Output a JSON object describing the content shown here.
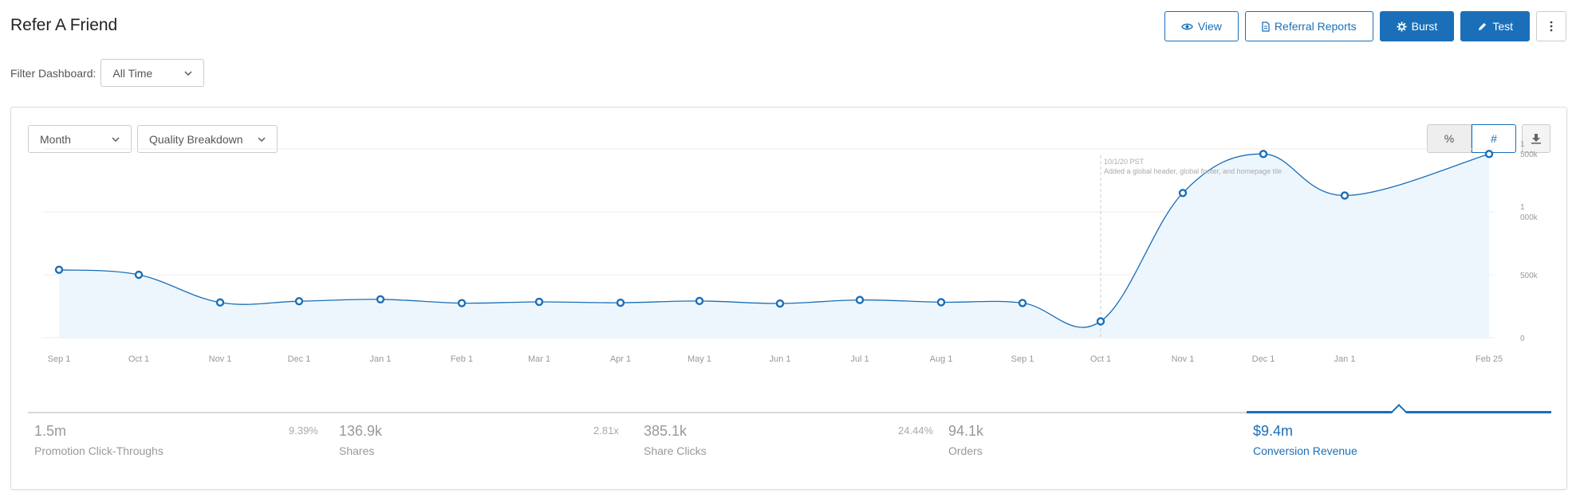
{
  "page": {
    "title": "Refer A Friend"
  },
  "toolbar": {
    "view_label": "View",
    "reports_label": "Referral Reports",
    "burst_label": "Burst",
    "test_label": "Test"
  },
  "filter": {
    "label": "Filter Dashboard:",
    "value": "All Time"
  },
  "panel": {
    "period_select": "Month",
    "breakdown_select": "Quality Breakdown",
    "toggle_percent": "%",
    "toggle_count": "#"
  },
  "colors": {
    "accent": "#1a6fb8",
    "area_fill": "#eef6fd",
    "grid": "#ececec",
    "tick_text": "#999999"
  },
  "chart_data": {
    "type": "area",
    "x": [
      "Sep 1",
      "Oct 1",
      "Nov 1",
      "Dec 1",
      "Jan 1",
      "Feb 1",
      "Mar 1",
      "Apr 1",
      "May 1",
      "Jun 1",
      "Jul 1",
      "Aug 1",
      "Sep 1",
      "Oct 1",
      "Nov 1",
      "Dec 1",
      "Jan 1",
      "Feb 25"
    ],
    "y_ticks": [
      "0",
      "500k",
      "1 000k",
      "1 500k"
    ],
    "ylim": [
      0,
      1500000
    ],
    "series": [
      {
        "values": [
          540000,
          500000,
          280000,
          290000,
          305000,
          275000,
          285000,
          278000,
          292000,
          272000,
          300000,
          282000,
          276000,
          130000,
          1150000,
          1460000,
          1130000,
          1460000
        ]
      }
    ],
    "annotation": {
      "x": "Oct 1",
      "date": "10/1/20 PST",
      "text": "Added a global header, global footer, and homepage tile"
    },
    "grid": true,
    "y_axis_position": "right"
  },
  "metrics": [
    {
      "value": "1.5m",
      "label": "Promotion Click-Throughs",
      "pct": ""
    },
    {
      "value": "136.9k",
      "label": "Shares",
      "pct": "9.39%"
    },
    {
      "value": "385.1k",
      "label": "Share Clicks",
      "pct": "2.81x"
    },
    {
      "value": "94.1k",
      "label": "Orders",
      "pct": "24.44%"
    },
    {
      "value": "$9.4m",
      "label": "Conversion Revenue",
      "pct": ""
    }
  ],
  "active_metric": 4
}
